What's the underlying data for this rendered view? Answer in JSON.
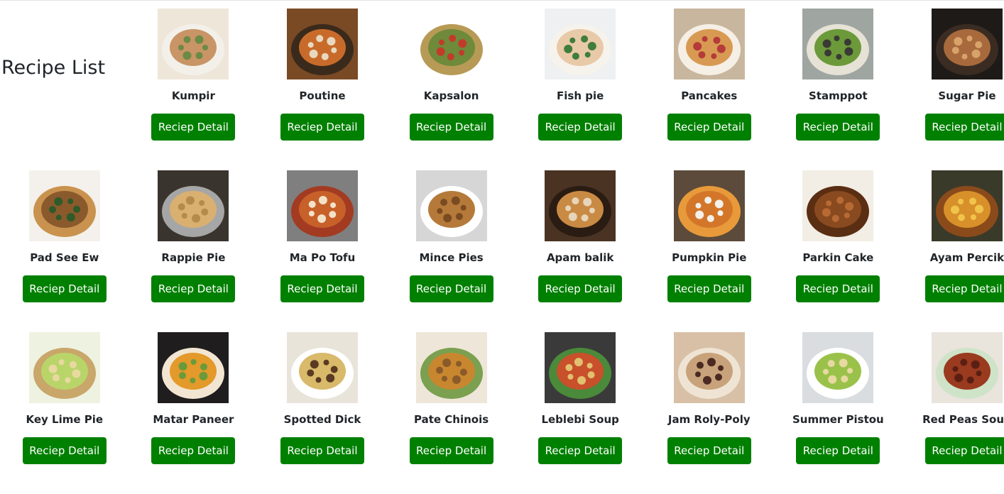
{
  "page": {
    "title": "Recipe List"
  },
  "button_label": "Reciep Detail",
  "recipes": [
    {
      "name": "Kumpir",
      "palette": [
        "#efe6da",
        "#c99566",
        "#6b8a45",
        "#f3f0ea"
      ]
    },
    {
      "name": "Poutine",
      "palette": [
        "#7a4a25",
        "#c86b2a",
        "#e8d8c0",
        "#3a2a1c"
      ]
    },
    {
      "name": "Kapsalon",
      "palette": [
        "#ffffff",
        "#6e8a3a",
        "#c23b2a",
        "#b79a55"
      ]
    },
    {
      "name": "Fish pie",
      "palette": [
        "#eef0f2",
        "#e8c9a8",
        "#3f7d3a",
        "#f6f3ec"
      ]
    },
    {
      "name": "Pancakes",
      "palette": [
        "#c8b79e",
        "#d89a52",
        "#b53a3a",
        "#f5efe6"
      ]
    },
    {
      "name": "Stamppot",
      "palette": [
        "#9fa6a2",
        "#6c9a3a",
        "#3a3a35",
        "#e7e2d6"
      ]
    },
    {
      "name": "Sugar Pie",
      "palette": [
        "#1e1a18",
        "#a86a3c",
        "#d7a36b",
        "#3a2c22"
      ]
    },
    {
      "name": "Pad See Ew",
      "palette": [
        "#f4f1ec",
        "#8a5a2c",
        "#2f5a2a",
        "#c9934f"
      ]
    },
    {
      "name": "Rappie Pie",
      "palette": [
        "#3a342e",
        "#d9b070",
        "#b58a4a",
        "#a6a6a6"
      ]
    },
    {
      "name": "Ma Po Tofu",
      "palette": [
        "#7f7f7f",
        "#c8602a",
        "#f2e2c8",
        "#a23b22"
      ]
    },
    {
      "name": "Mince Pies",
      "palette": [
        "#d6d6d6",
        "#b57a3a",
        "#7a4a20",
        "#ffffff"
      ]
    },
    {
      "name": "Apam balik",
      "palette": [
        "#4a3322",
        "#c98a44",
        "#e7d5b9",
        "#2a1c12"
      ]
    },
    {
      "name": "Pumpkin Pie",
      "palette": [
        "#5c4b3a",
        "#d3762a",
        "#f4f0ea",
        "#e89a3a"
      ]
    },
    {
      "name": "Parkin Cake",
      "palette": [
        "#f2eee6",
        "#8a4a1f",
        "#b86a34",
        "#5a2e12"
      ]
    },
    {
      "name": "Ayam Percik",
      "palette": [
        "#3a3a2a",
        "#d8902a",
        "#f0c44a",
        "#8a4a1a"
      ]
    },
    {
      "name": "Key Lime Pie",
      "palette": [
        "#eef2e0",
        "#b9d56a",
        "#e9d9a0",
        "#c9a66a"
      ]
    },
    {
      "name": "Matar Paneer",
      "palette": [
        "#1f1d1d",
        "#e39a2a",
        "#6a9a3a",
        "#f2e6d2"
      ]
    },
    {
      "name": "Spotted Dick",
      "palette": [
        "#e9e4da",
        "#d9b96a",
        "#5a3a22",
        "#ffffff"
      ]
    },
    {
      "name": "Pate Chinois",
      "palette": [
        "#eee6d8",
        "#c8872f",
        "#8a5a2a",
        "#7aa050"
      ]
    },
    {
      "name": "Leblebi Soup",
      "palette": [
        "#3a3a3a",
        "#c8502a",
        "#e2c070",
        "#4a8a3a"
      ]
    },
    {
      "name": "Jam Roly-Poly",
      "palette": [
        "#d8c0a6",
        "#c8a27a",
        "#4a2a22",
        "#efe4d4"
      ]
    },
    {
      "name": "Summer Pistou",
      "palette": [
        "#d9dde0",
        "#9ac24a",
        "#e8d9a2",
        "#ffffff"
      ]
    },
    {
      "name": "Red Peas Soup",
      "palette": [
        "#e9e4dc",
        "#9a3a1f",
        "#5a1f12",
        "#cfe3c8"
      ]
    }
  ]
}
